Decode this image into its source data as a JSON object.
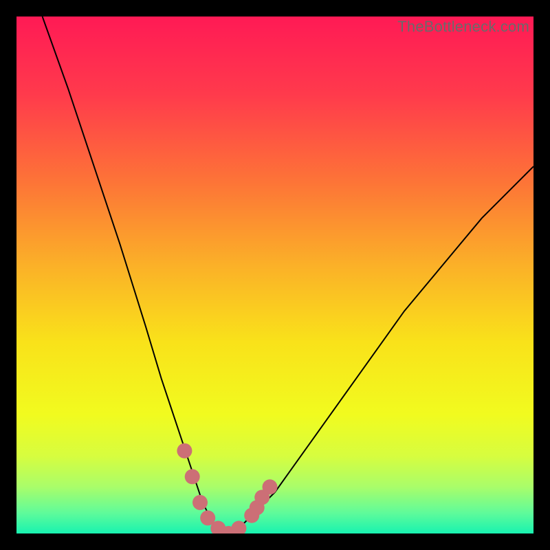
{
  "watermark": "TheBottleneck.com",
  "chart_data": {
    "type": "line",
    "title": "",
    "xlabel": "",
    "ylabel": "",
    "xlim": [
      0,
      100
    ],
    "ylim": [
      0,
      100
    ],
    "series": [
      {
        "name": "bottleneck-curve",
        "x": [
          5,
          10,
          15,
          20,
          25,
          28,
          30,
          32,
          34,
          36,
          38,
          40,
          42,
          44,
          50,
          55,
          60,
          65,
          70,
          75,
          80,
          85,
          90,
          95,
          100
        ],
        "y": [
          100,
          86,
          71,
          56,
          40,
          30,
          24,
          18,
          12,
          6,
          2,
          0,
          0,
          2,
          8,
          15,
          22,
          29,
          36,
          43,
          49,
          55,
          61,
          66,
          71
        ]
      }
    ],
    "annotations": [
      {
        "name": "marker-cluster",
        "color": "#cc6f76",
        "points": [
          {
            "x": 32.5,
            "y": 16
          },
          {
            "x": 34,
            "y": 11
          },
          {
            "x": 35.5,
            "y": 6
          },
          {
            "x": 37,
            "y": 3
          },
          {
            "x": 39,
            "y": 1
          },
          {
            "x": 41,
            "y": 0
          },
          {
            "x": 43,
            "y": 1
          },
          {
            "x": 45.5,
            "y": 3.5
          },
          {
            "x": 46.5,
            "y": 5
          },
          {
            "x": 47.5,
            "y": 7
          },
          {
            "x": 49,
            "y": 9
          }
        ]
      }
    ],
    "background_gradient": {
      "type": "vertical",
      "stops": [
        {
          "pos": 0.0,
          "color": "#ff1a55"
        },
        {
          "pos": 0.15,
          "color": "#ff3a4c"
        },
        {
          "pos": 0.32,
          "color": "#fd7437"
        },
        {
          "pos": 0.48,
          "color": "#fbb028"
        },
        {
          "pos": 0.63,
          "color": "#f9e21a"
        },
        {
          "pos": 0.77,
          "color": "#f1fb1f"
        },
        {
          "pos": 0.85,
          "color": "#d7fd3f"
        },
        {
          "pos": 0.91,
          "color": "#a9fd6a"
        },
        {
          "pos": 0.96,
          "color": "#5ffb9a"
        },
        {
          "pos": 1.0,
          "color": "#18f3b0"
        }
      ]
    }
  }
}
